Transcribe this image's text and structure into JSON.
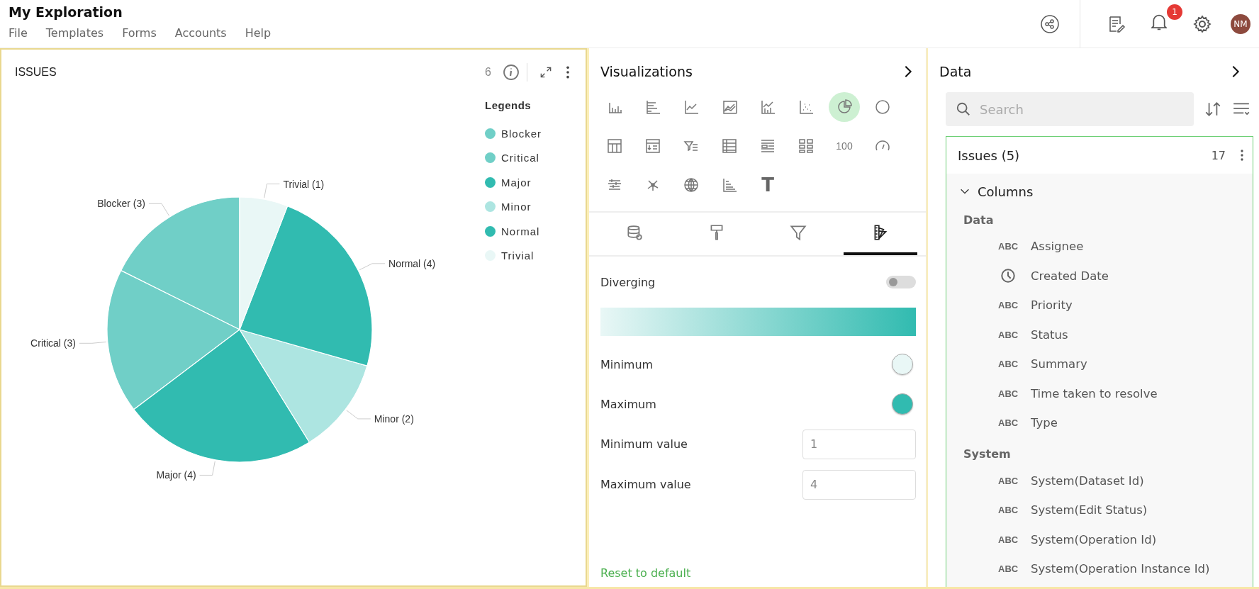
{
  "app": {
    "title": "My Exploration",
    "menu": [
      "File",
      "Templates",
      "Forms",
      "Accounts",
      "Help"
    ],
    "notifications": "1",
    "avatar": "NM"
  },
  "chart_panel": {
    "title": "ISSUES",
    "count": "6",
    "legend_title": "Legends",
    "legend": [
      {
        "label": "Blocker",
        "color": "#70cfc7"
      },
      {
        "label": "Critical",
        "color": "#70cfc7"
      },
      {
        "label": "Major",
        "color": "#31bbb0"
      },
      {
        "label": "Minor",
        "color": "#ade5e1"
      },
      {
        "label": "Normal",
        "color": "#31bbb0"
      },
      {
        "label": "Trivial",
        "color": "#e9f7f6"
      }
    ],
    "chart_data": {
      "type": "pie",
      "values": [
        3,
        3,
        4,
        2,
        4,
        1
      ],
      "value_labels": [
        "Blocker (3)",
        "Critical (3)",
        "Major (4)",
        "Minor (2)",
        "Normal (4)",
        "Trivial (1)"
      ]
    }
  },
  "visualizations": {
    "title": "Visualizations",
    "types": [
      {
        "kind": "column",
        "selected": false
      },
      {
        "kind": "bar",
        "selected": false
      },
      {
        "kind": "line",
        "selected": false
      },
      {
        "kind": "area",
        "selected": false
      },
      {
        "kind": "combo",
        "selected": false
      },
      {
        "kind": "scatter",
        "selected": false
      },
      {
        "kind": "pie",
        "selected": true
      },
      {
        "kind": "donut",
        "selected": false
      },
      {
        "kind": "pivot",
        "selected": false
      },
      {
        "kind": "detail",
        "selected": false
      },
      {
        "kind": "filter-list",
        "selected": false
      },
      {
        "kind": "table",
        "selected": false
      },
      {
        "kind": "list",
        "selected": false
      },
      {
        "kind": "cards",
        "selected": false
      },
      {
        "kind": "number",
        "label": "100",
        "selected": false
      },
      {
        "kind": "gauge",
        "selected": false
      },
      {
        "kind": "heatmap",
        "selected": false
      },
      {
        "kind": "network",
        "selected": false
      },
      {
        "kind": "map",
        "selected": false
      },
      {
        "kind": "stepped",
        "selected": false
      },
      {
        "kind": "text",
        "label": "T",
        "selected": false
      }
    ],
    "tabs": [
      {
        "kind": "data",
        "selected": false
      },
      {
        "kind": "format",
        "selected": false
      },
      {
        "kind": "filter",
        "selected": false
      },
      {
        "kind": "palette",
        "selected": true
      }
    ],
    "diverging": {
      "label": "Diverging",
      "on": false
    },
    "colors": [
      {
        "label": "Minimum",
        "color": "#e9f7f6"
      },
      {
        "label": "Maximum",
        "color": "#31bbb0"
      }
    ],
    "values": [
      {
        "label": "Minimum value",
        "value": "1"
      },
      {
        "label": "Maximum value",
        "value": "4"
      }
    ],
    "reset": "Reset to default"
  },
  "data_panel": {
    "title": "Data",
    "search_placeholder": "Search",
    "dataset": {
      "name": "Issues (5)",
      "count": "17",
      "section": "Columns",
      "expanded": true,
      "groups": [
        {
          "label": "Data",
          "fields": [
            {
              "kind": "text",
              "badge": "ABC",
              "name": "Assignee"
            },
            {
              "kind": "date",
              "name": "Created Date"
            },
            {
              "kind": "text",
              "badge": "ABC",
              "name": "Priority"
            },
            {
              "kind": "text",
              "badge": "ABC",
              "name": "Status"
            },
            {
              "kind": "text",
              "badge": "ABC",
              "name": "Summary"
            },
            {
              "kind": "text",
              "badge": "ABC",
              "name": "Time taken to resolve"
            },
            {
              "kind": "text",
              "badge": "ABC",
              "name": "Type"
            }
          ]
        },
        {
          "label": "System",
          "fields": [
            {
              "kind": "text",
              "badge": "ABC",
              "name": "System(Dataset Id)"
            },
            {
              "kind": "text",
              "badge": "ABC",
              "name": "System(Edit Status)"
            },
            {
              "kind": "text",
              "badge": "ABC",
              "name": "System(Operation Id)"
            },
            {
              "kind": "text",
              "badge": "ABC",
              "name": "System(Operation Instance Id)"
            }
          ]
        }
      ]
    }
  }
}
